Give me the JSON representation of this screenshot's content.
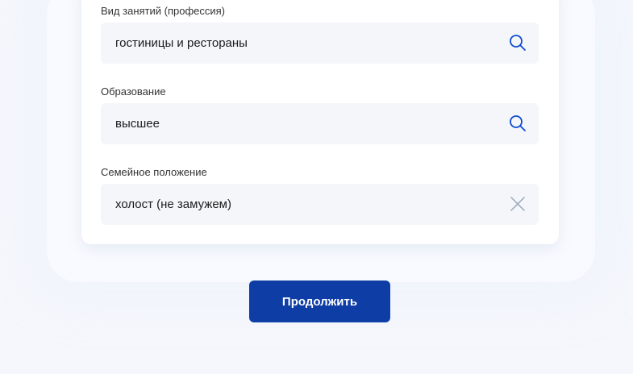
{
  "form": {
    "fields": [
      {
        "label": "Вид занятий (профессия)",
        "value": "гостиницы и рестораны",
        "icon": "search-icon"
      },
      {
        "label": "Образование",
        "value": "высшее",
        "icon": "search-icon"
      },
      {
        "label": "Семейное положение",
        "value": "холост (не замужем)",
        "icon": "clear-icon"
      }
    ]
  },
  "actions": {
    "continue_label": "Продолжить"
  },
  "colors": {
    "primary_button": "#0d3da5",
    "search_icon": "#0d4cd3",
    "clear_icon": "#9aa6bd",
    "field_background": "#f5f6f9",
    "page_background": "#f5f7fc"
  }
}
